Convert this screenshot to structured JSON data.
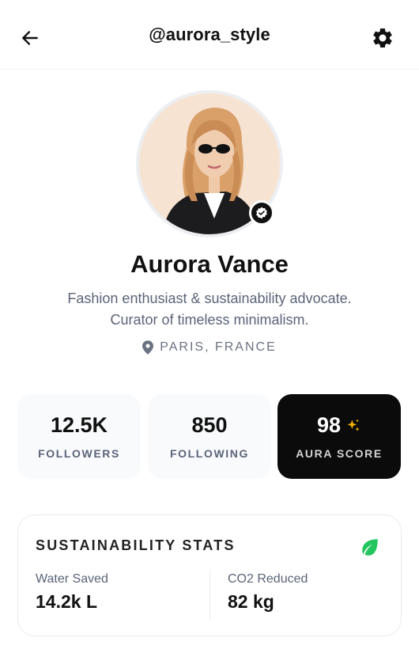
{
  "header": {
    "handle": "@aurora_style",
    "back_icon": "arrow-left-icon",
    "settings_icon": "gear-icon"
  },
  "profile": {
    "name": "Aurora Vance",
    "bio": "Fashion enthusiast & sustainability advocate. Curator of timeless minimalism.",
    "location": "PARIS, FRANCE",
    "verified": true
  },
  "stats": [
    {
      "value": "12.5K",
      "label": "FOLLOWERS"
    },
    {
      "value": "850",
      "label": "FOLLOWING"
    },
    {
      "value": "98",
      "label": "AURA SCORE",
      "icon": "sparkle-icon"
    }
  ],
  "sustainability": {
    "title": "SUSTAINABILITY STATS",
    "icon": "leaf-icon",
    "metrics": [
      {
        "label": "Water Saved",
        "value": "14.2k L"
      },
      {
        "label": "CO2 Reduced",
        "value": "82 kg"
      }
    ]
  },
  "colors": {
    "accent_dark": "#0b0b0b",
    "leaf_green": "#22c55e",
    "sparkle_gold": "#f5b301"
  }
}
